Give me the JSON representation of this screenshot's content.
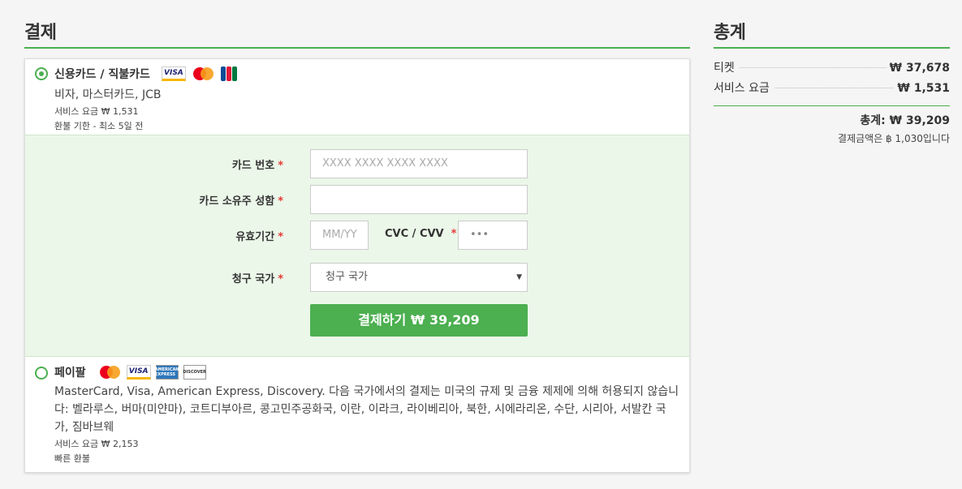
{
  "checkout": {
    "title": "결제",
    "card_option": {
      "title": "신용카드 / 직불카드",
      "logos": [
        "VISA",
        "MasterCard",
        "JCB"
      ],
      "subtitle": "비자, 마스터카드, JCB",
      "fee": "서비스 요금 ₩ 1,531",
      "refund": "환불 기한 - 최소 5일 전",
      "selected": true
    },
    "form": {
      "card_number_label": "카드 번호",
      "card_number_placeholder": "XXXX XXXX XXXX XXXX",
      "holder_label": "카드 소유주 성함",
      "holder_value": "",
      "expiry_label": "유효기간",
      "expiry_placeholder": "MM/YY",
      "cvv_label": "CVC / CVV",
      "cvv_placeholder": "•••",
      "country_label": "청구 국가",
      "country_value": "청구 국가",
      "required_mark": "*",
      "pay_button": "결제하기 ₩ 39,209"
    },
    "paypal_option": {
      "title": "페이팔",
      "logos": [
        "MasterCard",
        "VISA",
        "AMERICAN EXPRESS",
        "DISCOVER"
      ],
      "description": "MasterCard, Visa, American Express, Discovery. 다음 국가에서의 결제는 미국의 규제 및 금융 제제에 의해 허용되지 않습니다: 벨라루스, 버마(미얀마), 코트디부아르, 콩고민주공화국, 이란, 이라크, 라이베리아, 북한, 시에라리온, 수단, 시리아, 서발칸 국가, 짐바브웨",
      "fee": "서비스 요금 ₩ 2,153",
      "refund": "빠른 환불",
      "selected": false
    }
  },
  "summary": {
    "title": "총계",
    "rows": [
      {
        "label": "티켓",
        "value": "₩ 37,678"
      },
      {
        "label": "서비스 요금",
        "value": "₩ 1,531"
      }
    ],
    "total": "총계: ₩ 39,209",
    "note": "결제금액은 ฿ 1,030입니다"
  },
  "colors": {
    "accent": "#4caf50",
    "form_bg": "#ebf7e9",
    "required": "#e53935"
  }
}
